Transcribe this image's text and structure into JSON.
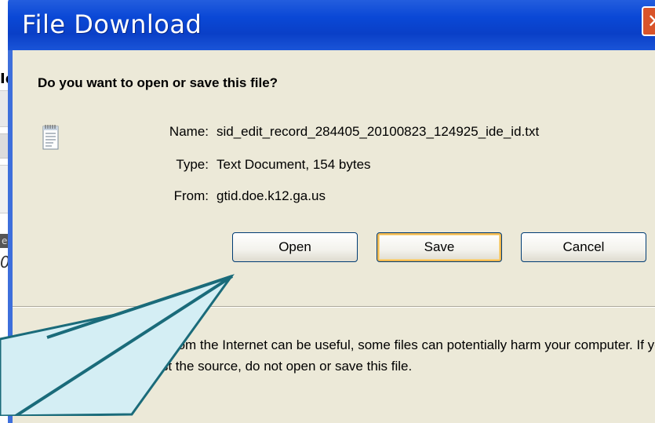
{
  "background": {
    "fragment_text": "Id",
    "dark_label": "e",
    "italic_text": "0"
  },
  "dialog": {
    "title": "File Download",
    "close_glyph": "✕",
    "question": "Do you want to open or save this file?",
    "file_icon": "text-document-icon",
    "info": {
      "name_label": "Name:",
      "name_value": "sid_edit_record_284405_20100823_124925_ide_id.txt",
      "type_label": "Type:",
      "type_value": "Text Document, 154 bytes",
      "from_label": "From:",
      "from_value": "gtid.doe.k12.ga.us"
    },
    "buttons": {
      "open": "Open",
      "save": "Save",
      "cancel": "Cancel"
    },
    "warning": "While files from the Internet can be useful, some files can potentially harm your computer. If you do not trust the source, do not open or save this file."
  },
  "colors": {
    "titlebar": "#0a48d6",
    "client": "#ece9d8",
    "callout_fill": "#d4eef4",
    "callout_stroke": "#1a6b7a"
  }
}
